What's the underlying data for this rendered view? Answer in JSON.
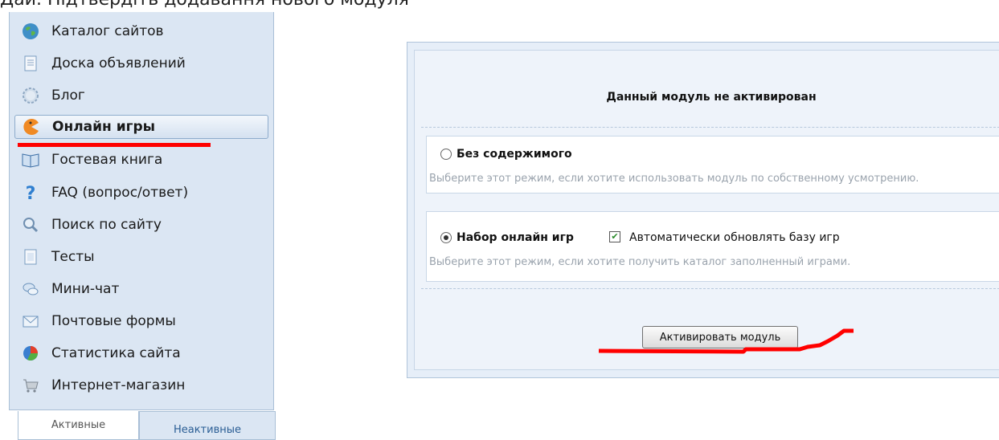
{
  "caption": "Дай. Підтвердіть додавання нового модуля",
  "sidebar": {
    "items": [
      {
        "label": "Каталог сайтов",
        "icon": "globe-icon"
      },
      {
        "label": "Доска объявлений",
        "icon": "document-icon"
      },
      {
        "label": "Блог",
        "icon": "gear-icon"
      },
      {
        "label": "Онлайн игры",
        "icon": "pacman-icon"
      },
      {
        "label": "Гостевая книга",
        "icon": "book-icon"
      },
      {
        "label": "FAQ (вопрос/ответ)",
        "icon": "question-icon"
      },
      {
        "label": "Поиск по сайту",
        "icon": "magnifier-icon"
      },
      {
        "label": "Тесты",
        "icon": "document-lines-icon"
      },
      {
        "label": "Мини-чат",
        "icon": "chat-icon"
      },
      {
        "label": "Почтовые формы",
        "icon": "envelope-icon"
      },
      {
        "label": "Статистика сайта",
        "icon": "pie-chart-icon"
      },
      {
        "label": "Интернет-магазин",
        "icon": "cart-icon"
      }
    ],
    "active_index": 3,
    "tabs": {
      "active": "Активные",
      "inactive": "Неактивные"
    }
  },
  "panel": {
    "title": "Данный модуль не активирован",
    "option1": {
      "label": "Без содержимого",
      "description": "Выберите этот режим, если хотите использовать модуль по собственному усмотрению.",
      "selected": false
    },
    "option2": {
      "label": "Набор онлайн игр",
      "description": "Выберите этот режим, если хотите получить каталог заполненный играми.",
      "selected": true,
      "checkbox_label": "Автоматически обновлять базу игр",
      "checkbox_checked": true
    },
    "button_label": "Активировать модуль"
  },
  "colors": {
    "sidebar_bg": "#dbe6f3",
    "panel_bg": "#e6eef8",
    "annotation_red": "#ff0000"
  }
}
